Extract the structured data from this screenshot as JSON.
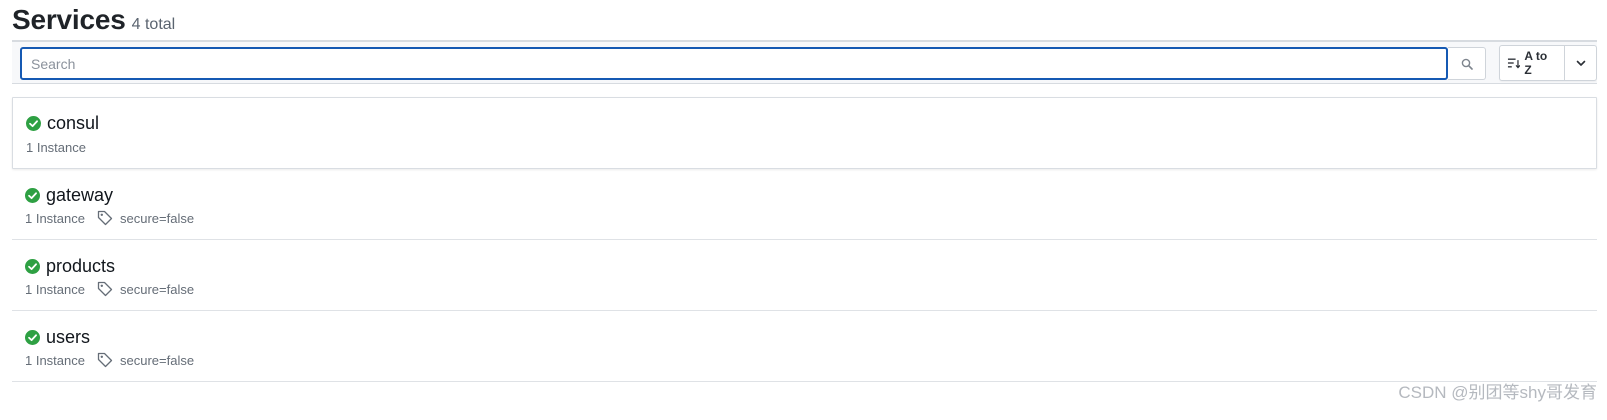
{
  "header": {
    "title": "Services",
    "count": "4 total"
  },
  "search": {
    "placeholder": "Search",
    "value": ""
  },
  "sort": {
    "label": "A to Z"
  },
  "services": [
    {
      "name": "consul",
      "instances": "1 Instance",
      "tag": ""
    },
    {
      "name": "gateway",
      "instances": "1 Instance",
      "tag": "secure=false"
    },
    {
      "name": "products",
      "instances": "1 Instance",
      "tag": "secure=false"
    },
    {
      "name": "users",
      "instances": "1 Instance",
      "tag": "secure=false"
    }
  ],
  "watermark": "CSDN @别团等shy哥发育",
  "colors": {
    "status_passing": "#2ea043",
    "focus_border": "#1559b3"
  },
  "icons": {
    "status": "check-circle-icon",
    "search": "search-icon",
    "sort": "sort-icon",
    "caret": "chevron-down-icon",
    "tag": "tag-icon"
  }
}
